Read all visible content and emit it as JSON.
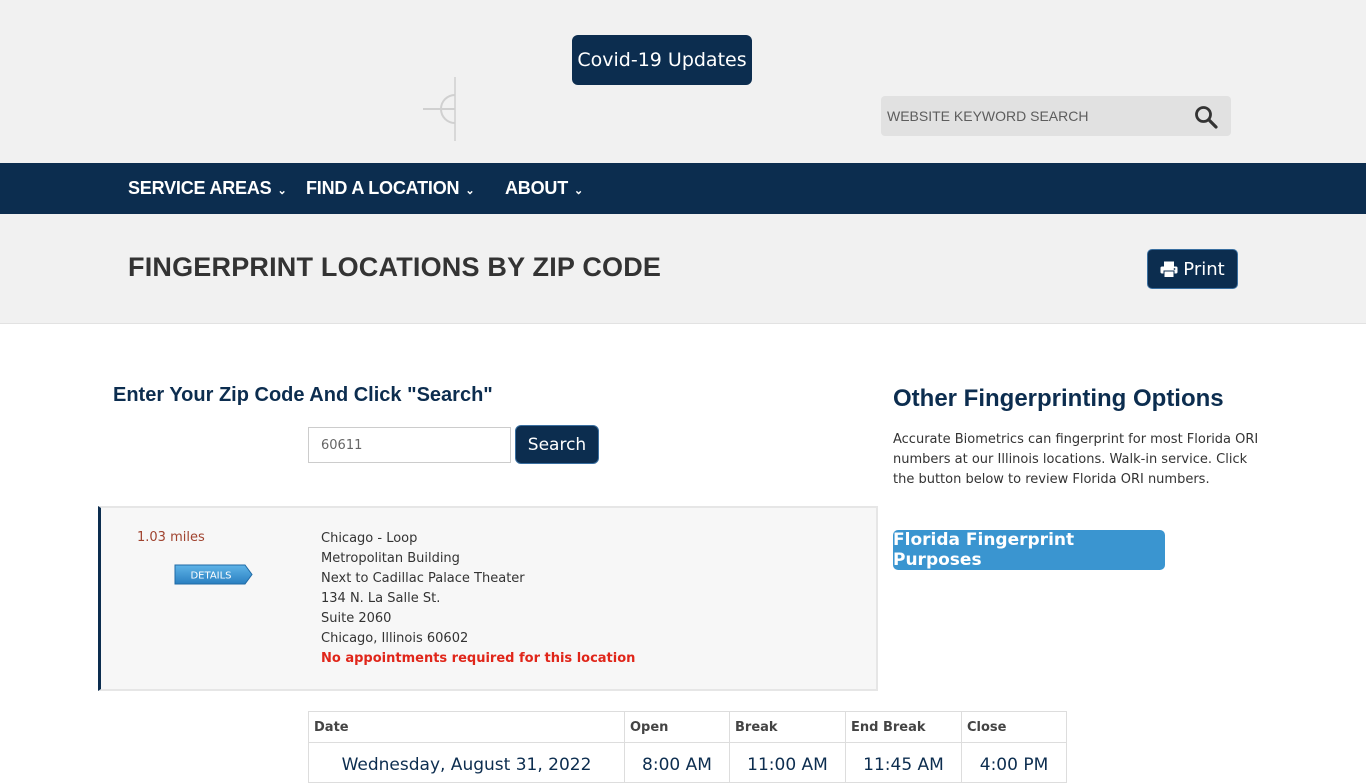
{
  "header": {
    "covid_label": "Covid-19 Updates",
    "search_placeholder": "WEBSITE KEYWORD SEARCH",
    "search_icon": "search-icon"
  },
  "nav": {
    "items": [
      {
        "label": "SERVICE AREAS"
      },
      {
        "label": "FIND A LOCATION"
      },
      {
        "label": "ABOUT"
      }
    ]
  },
  "title_bar": {
    "title": "FINGERPRINT LOCATIONS BY ZIP CODE",
    "print_label": "Print",
    "print_icon": "printer-icon"
  },
  "zip_search": {
    "heading": "Enter Your Zip Code And Click \"Search\"",
    "value": "60611",
    "button_label": "Search"
  },
  "result": {
    "distance": "1.03 miles",
    "details_label": "DETAILS",
    "address_lines": [
      "Chicago - Loop",
      "Metropolitan Building",
      "Next to Cadillac Palace Theater",
      "134 N. La Salle St.",
      "Suite 2060",
      "Chicago, Illinois 60602"
    ],
    "notice": "No appointments required for this location"
  },
  "schedule": {
    "headers": [
      "Date",
      "Open",
      "Break",
      "End Break",
      "Close"
    ],
    "rows": [
      [
        "Wednesday, August 31, 2022",
        "8:00 AM",
        "11:00 AM",
        "11:45 AM",
        "4:00 PM"
      ]
    ]
  },
  "sidebar": {
    "heading": "Other Fingerprinting Options",
    "text": "Accurate Biometrics can fingerprint for most Florida ORI numbers at our Illinois locations. Walk-in service. Click the button below to review Florida ORI numbers.",
    "button_label": "Florida Fingerprint Purposes"
  },
  "colors": {
    "navy": "#0c2d4f",
    "light_blue": "#3a95d0",
    "notice_red": "#e0261a",
    "distance_red": "#a0432f"
  }
}
